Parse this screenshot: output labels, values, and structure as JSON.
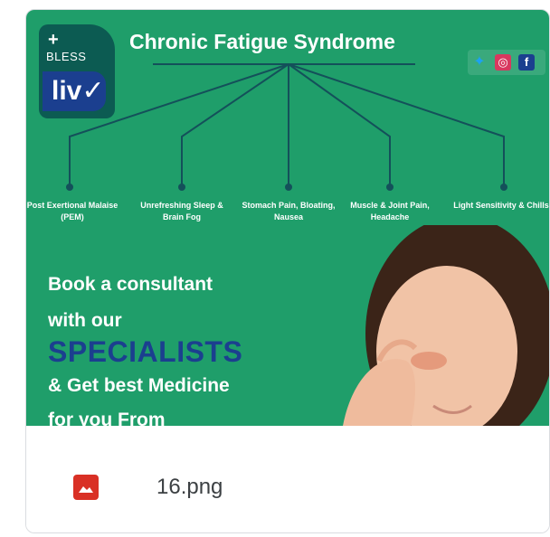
{
  "card": {
    "preview": {
      "brand_top": "BLESS",
      "brand_bottom": "liv",
      "title": "Chronic Fatigue Syndrome",
      "social": [
        "twitter-icon",
        "instagram-icon",
        "facebook-icon"
      ],
      "symptoms": [
        "Post Exertional Malaise (PEM)",
        "Unrefreshing Sleep & Brain Fog",
        "Stomach Pain, Bloating, Nausea",
        "Muscle & Joint Pain, Headache",
        "Light Sensitivity & Chills"
      ],
      "cta": {
        "line1": "Book a consultant",
        "line2": "with our",
        "line3": "SPECIALISTS",
        "line4": "& Get best Medicine",
        "line5": "for you From"
      },
      "colors": {
        "background": "#1f9e6a",
        "accent_blue": "#1b3f8f",
        "logo_dark": "#0c5b52"
      }
    },
    "file": {
      "icon": "image-file-icon",
      "icon_color": "#d93025",
      "name": "16.png"
    }
  }
}
